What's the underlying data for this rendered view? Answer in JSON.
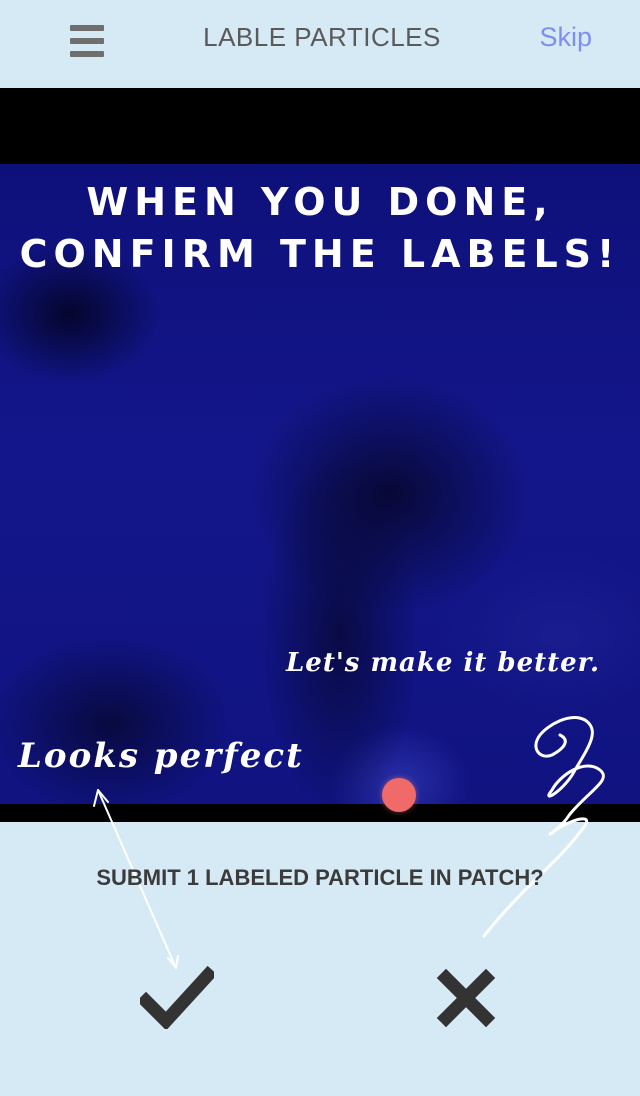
{
  "header": {
    "title": "LABLE PARTICLES",
    "skip_label": "Skip",
    "menu_icon": "hamburger-menu-icon"
  },
  "patch": {
    "instruction": "When you done, confirm the labels!",
    "annotation_better": "Let's make it better.",
    "annotation_perfect": "Looks perfect"
  },
  "confirmation": {
    "question": "SUBMIT 1 LABELED PARTICLE IN PATCH?",
    "confirm_icon": "checkmark-icon",
    "reject_icon": "close-x-icon"
  },
  "colors": {
    "background": "#d6eaf6",
    "accent_link": "#7f8ef2",
    "particle_marker": "#f06a6a",
    "patch_blue": "#13168a"
  }
}
